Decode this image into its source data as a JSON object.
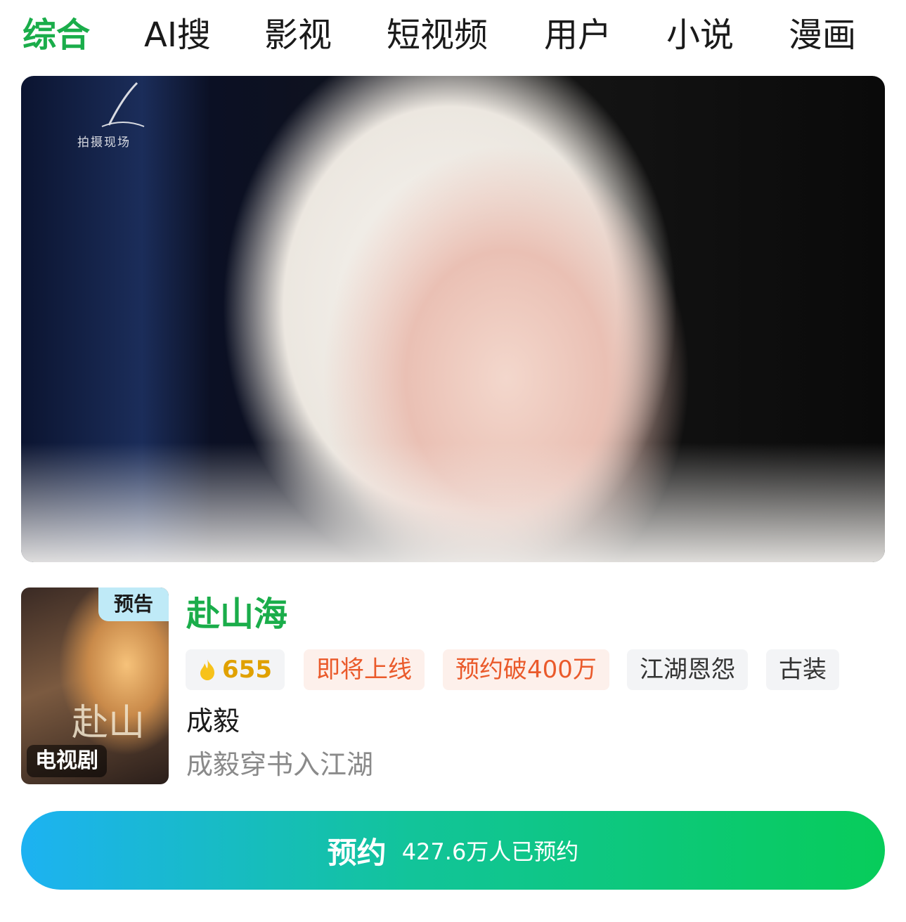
{
  "tabs": [
    {
      "label": "综合",
      "active": true
    },
    {
      "label": "AI搜"
    },
    {
      "label": "影视"
    },
    {
      "label": "短视频"
    },
    {
      "label": "用户"
    },
    {
      "label": "小说"
    },
    {
      "label": "漫画"
    }
  ],
  "hero": {
    "watermark": "拍摄现场"
  },
  "poster": {
    "badge_trailer": "预告",
    "badge_type": "电视剧",
    "title_art": "赴山"
  },
  "info": {
    "title": "赴山海",
    "hot_value": "655",
    "tags": [
      "即将上线",
      "预约破400万",
      "江湖恩怨",
      "古装"
    ],
    "author": "成毅",
    "description": "成毅穿书入江湖"
  },
  "cta": {
    "label": "预约",
    "sub": "427.6万人已预约"
  },
  "colors": {
    "accent_green": "#1aad4a",
    "tag_orange": "#ea5a2b",
    "hot_gold": "#e0a100",
    "cta_start": "#1db2f2",
    "cta_end": "#07cc5a"
  }
}
